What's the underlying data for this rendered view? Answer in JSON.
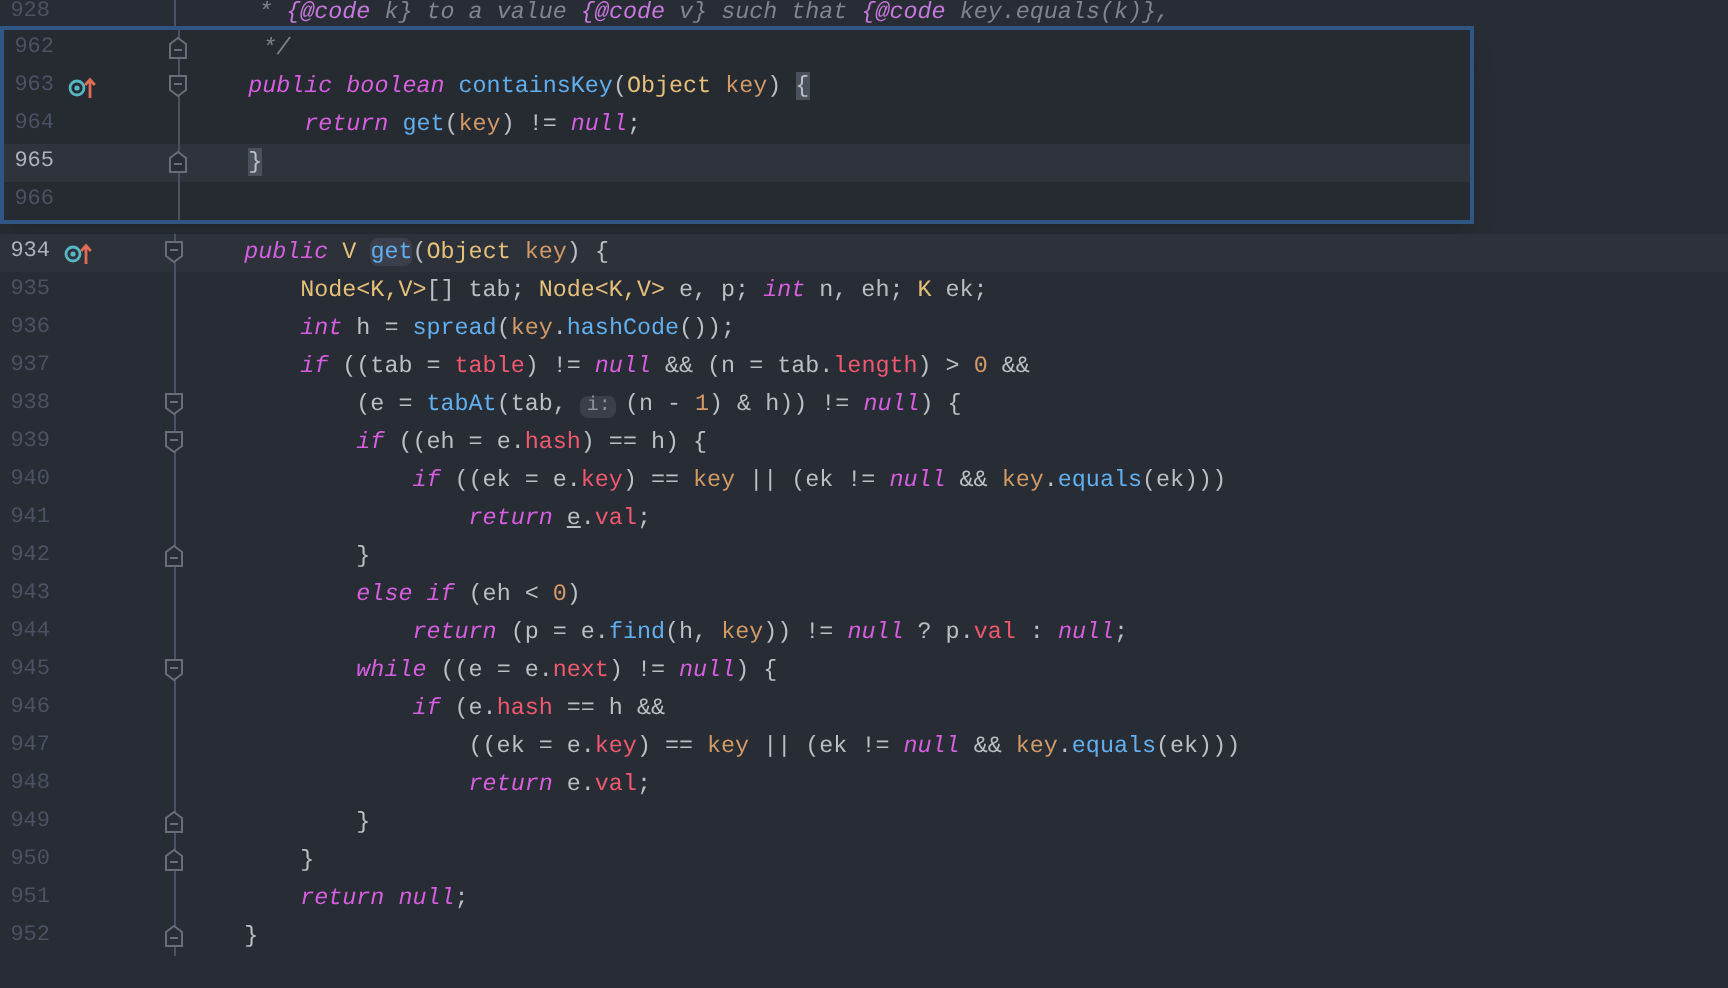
{
  "background_top_line": {
    "number": "928",
    "tokens": [
      {
        "t": "     * ",
        "kind": "comment"
      },
      {
        "t": "{@code",
        "kind": "tag"
      },
      {
        "t": " k} to a value ",
        "kind": "comment"
      },
      {
        "t": "{@code",
        "kind": "tag"
      },
      {
        "t": " v} such that ",
        "kind": "comment"
      },
      {
        "t": "{@code",
        "kind": "tag"
      },
      {
        "t": " key.equals(k)},",
        "kind": "comment"
      }
    ]
  },
  "popup": {
    "lines": [
      {
        "number": "962",
        "current": false,
        "marker": false,
        "fold_start": false,
        "fold_end": true,
        "tokens": [
          {
            "t": "     */",
            "kind": "comment"
          }
        ]
      },
      {
        "number": "963",
        "current": false,
        "marker": true,
        "fold_start": true,
        "fold_end": false,
        "tokens": [
          {
            "t": "    public ",
            "kind": "keyword"
          },
          {
            "t": "boolean ",
            "kind": "keyword"
          },
          {
            "t": "containsKey",
            "kind": "function"
          },
          {
            "t": "(",
            "kind": "plain"
          },
          {
            "t": "Object ",
            "kind": "type"
          },
          {
            "t": "key",
            "kind": "param"
          },
          {
            "t": ") ",
            "kind": "plain"
          },
          {
            "t": "{",
            "kind": "brace"
          }
        ]
      },
      {
        "number": "964",
        "current": false,
        "marker": false,
        "fold_start": false,
        "fold_end": false,
        "tokens": [
          {
            "t": "        return ",
            "kind": "keyword"
          },
          {
            "t": "get",
            "kind": "function"
          },
          {
            "t": "(",
            "kind": "plain"
          },
          {
            "t": "key",
            "kind": "param"
          },
          {
            "t": ") != ",
            "kind": "plain"
          },
          {
            "t": "null",
            "kind": "keyword"
          },
          {
            "t": ";",
            "kind": "plain"
          }
        ]
      },
      {
        "number": "965",
        "current": true,
        "marker": false,
        "fold_start": false,
        "fold_end": true,
        "tokens": [
          {
            "t": "    }",
            "kind": "brace"
          }
        ]
      },
      {
        "number": "966",
        "current": false,
        "marker": false,
        "fold_start": false,
        "fold_end": false
      }
    ]
  },
  "editor": {
    "lines": [
      {
        "number": "934",
        "current": true,
        "marker": true,
        "fold_start": true,
        "fold_end": false,
        "tokens": [
          {
            "t": "    public ",
            "kind": "keyword"
          },
          {
            "t": "V ",
            "kind": "type"
          },
          {
            "t": "get",
            "kind": "function_highlight"
          },
          {
            "t": "(",
            "kind": "plain"
          },
          {
            "t": "Object ",
            "kind": "type"
          },
          {
            "t": "key",
            "kind": "param"
          },
          {
            "t": ") {",
            "kind": "plain"
          }
        ]
      },
      {
        "number": "935",
        "current": false,
        "marker": false,
        "fold_start": false,
        "fold_end": false,
        "tokens": [
          {
            "t": "        Node<K,V>",
            "kind": "type"
          },
          {
            "t": "[] tab; ",
            "kind": "plain"
          },
          {
            "t": "Node<K,V>",
            "kind": "type"
          },
          {
            "t": " e, p; ",
            "kind": "plain"
          },
          {
            "t": "int",
            "kind": "keyword"
          },
          {
            "t": " n, eh; ",
            "kind": "plain"
          },
          {
            "t": "K",
            "kind": "type"
          },
          {
            "t": " ek;",
            "kind": "plain"
          }
        ]
      },
      {
        "number": "936",
        "current": false,
        "marker": false,
        "fold_start": false,
        "fold_end": false,
        "tokens": [
          {
            "t": "        int",
            "kind": "keyword"
          },
          {
            "t": " h = ",
            "kind": "plain"
          },
          {
            "t": "spread",
            "kind": "function"
          },
          {
            "t": "(",
            "kind": "plain"
          },
          {
            "t": "key",
            "kind": "param"
          },
          {
            "t": ".",
            "kind": "plain"
          },
          {
            "t": "hashCode",
            "kind": "function"
          },
          {
            "t": "());",
            "kind": "plain"
          }
        ]
      },
      {
        "number": "937",
        "current": false,
        "marker": false,
        "fold_start": false,
        "fold_end": false,
        "tokens": [
          {
            "t": "        if",
            "kind": "keyword"
          },
          {
            "t": " ((tab = ",
            "kind": "plain"
          },
          {
            "t": "table",
            "kind": "field"
          },
          {
            "t": ") != ",
            "kind": "plain"
          },
          {
            "t": "null",
            "kind": "keyword"
          },
          {
            "t": " && (n = tab.",
            "kind": "plain"
          },
          {
            "t": "length",
            "kind": "field"
          },
          {
            "t": ") > ",
            "kind": "plain"
          },
          {
            "t": "0",
            "kind": "number"
          },
          {
            "t": " &&",
            "kind": "plain"
          }
        ]
      },
      {
        "number": "938",
        "current": false,
        "marker": false,
        "fold_start": true,
        "fold_end": false,
        "tokens": [
          {
            "t": "            (e = ",
            "kind": "plain"
          },
          {
            "t": "tabAt",
            "kind": "function"
          },
          {
            "t": "(tab, ",
            "kind": "plain"
          },
          {
            "t": "i:",
            "kind": "hint"
          },
          {
            "t": "(n - ",
            "kind": "plain"
          },
          {
            "t": "1",
            "kind": "number"
          },
          {
            "t": ") & h)) != ",
            "kind": "plain"
          },
          {
            "t": "null",
            "kind": "keyword"
          },
          {
            "t": ") {",
            "kind": "plain"
          }
        ]
      },
      {
        "number": "939",
        "current": false,
        "marker": false,
        "fold_start": true,
        "fold_end": false,
        "tokens": [
          {
            "t": "            if",
            "kind": "keyword"
          },
          {
            "t": " ((eh = e.",
            "kind": "plain"
          },
          {
            "t": "hash",
            "kind": "field"
          },
          {
            "t": ") == h) {",
            "kind": "plain"
          }
        ]
      },
      {
        "number": "940",
        "current": false,
        "marker": false,
        "fold_start": false,
        "fold_end": false,
        "tokens": [
          {
            "t": "                if",
            "kind": "keyword"
          },
          {
            "t": " ((ek = e.",
            "kind": "plain"
          },
          {
            "t": "key",
            "kind": "field"
          },
          {
            "t": ") == ",
            "kind": "plain"
          },
          {
            "t": "key",
            "kind": "param"
          },
          {
            "t": " || (ek != ",
            "kind": "plain"
          },
          {
            "t": "null",
            "kind": "keyword"
          },
          {
            "t": " && ",
            "kind": "plain"
          },
          {
            "t": "key",
            "kind": "param"
          },
          {
            "t": ".",
            "kind": "plain"
          },
          {
            "t": "equals",
            "kind": "function"
          },
          {
            "t": "(ek)))",
            "kind": "plain"
          }
        ]
      },
      {
        "number": "941",
        "current": false,
        "marker": false,
        "fold_start": false,
        "fold_end": false,
        "tokens": [
          {
            "t": "                    return ",
            "kind": "keyword"
          },
          {
            "t": "e",
            "kind": "underlined"
          },
          {
            "t": ".",
            "kind": "plain"
          },
          {
            "t": "val",
            "kind": "field"
          },
          {
            "t": ";",
            "kind": "plain"
          }
        ]
      },
      {
        "number": "942",
        "current": false,
        "marker": false,
        "fold_start": false,
        "fold_end": true,
        "tokens": [
          {
            "t": "            }",
            "kind": "plain"
          }
        ]
      },
      {
        "number": "943",
        "current": false,
        "marker": false,
        "fold_start": false,
        "fold_end": false,
        "tokens": [
          {
            "t": "            else ",
            "kind": "keyword"
          },
          {
            "t": "if",
            "kind": "keyword"
          },
          {
            "t": " (eh < ",
            "kind": "plain"
          },
          {
            "t": "0",
            "kind": "number"
          },
          {
            "t": ")",
            "kind": "plain"
          }
        ]
      },
      {
        "number": "944",
        "current": false,
        "marker": false,
        "fold_start": false,
        "fold_end": false,
        "tokens": [
          {
            "t": "                return",
            "kind": "keyword"
          },
          {
            "t": " (p = e.",
            "kind": "plain"
          },
          {
            "t": "find",
            "kind": "function"
          },
          {
            "t": "(h, ",
            "kind": "plain"
          },
          {
            "t": "key",
            "kind": "param"
          },
          {
            "t": ")) != ",
            "kind": "plain"
          },
          {
            "t": "null",
            "kind": "keyword"
          },
          {
            "t": " ? p.",
            "kind": "plain"
          },
          {
            "t": "val",
            "kind": "field"
          },
          {
            "t": " : ",
            "kind": "plain"
          },
          {
            "t": "null",
            "kind": "keyword"
          },
          {
            "t": ";",
            "kind": "plain"
          }
        ]
      },
      {
        "number": "945",
        "current": false,
        "marker": false,
        "fold_start": true,
        "fold_end": false,
        "tokens": [
          {
            "t": "            while",
            "kind": "keyword"
          },
          {
            "t": " ((e = e.",
            "kind": "plain"
          },
          {
            "t": "next",
            "kind": "field"
          },
          {
            "t": ") != ",
            "kind": "plain"
          },
          {
            "t": "null",
            "kind": "keyword"
          },
          {
            "t": ") {",
            "kind": "plain"
          }
        ]
      },
      {
        "number": "946",
        "current": false,
        "marker": false,
        "fold_start": false,
        "fold_end": false,
        "tokens": [
          {
            "t": "                if",
            "kind": "keyword"
          },
          {
            "t": " (e.",
            "kind": "plain"
          },
          {
            "t": "hash",
            "kind": "field"
          },
          {
            "t": " == h &&",
            "kind": "plain"
          }
        ]
      },
      {
        "number": "947",
        "current": false,
        "marker": false,
        "fold_start": false,
        "fold_end": false,
        "tokens": [
          {
            "t": "                    ((ek = e.",
            "kind": "plain"
          },
          {
            "t": "key",
            "kind": "field"
          },
          {
            "t": ") == ",
            "kind": "plain"
          },
          {
            "t": "key",
            "kind": "param"
          },
          {
            "t": " || (ek != ",
            "kind": "plain"
          },
          {
            "t": "null",
            "kind": "keyword"
          },
          {
            "t": " && ",
            "kind": "plain"
          },
          {
            "t": "key",
            "kind": "param"
          },
          {
            "t": ".",
            "kind": "plain"
          },
          {
            "t": "equals",
            "kind": "function"
          },
          {
            "t": "(ek)))",
            "kind": "plain"
          }
        ]
      },
      {
        "number": "948",
        "current": false,
        "marker": false,
        "fold_start": false,
        "fold_end": false,
        "tokens": [
          {
            "t": "                    return",
            "kind": "keyword"
          },
          {
            "t": " e.",
            "kind": "plain"
          },
          {
            "t": "val",
            "kind": "field"
          },
          {
            "t": ";",
            "kind": "plain"
          }
        ]
      },
      {
        "number": "949",
        "current": false,
        "marker": false,
        "fold_start": false,
        "fold_end": true,
        "tokens": [
          {
            "t": "            }",
            "kind": "plain"
          }
        ]
      },
      {
        "number": "950",
        "current": false,
        "marker": false,
        "fold_start": false,
        "fold_end": true,
        "tokens": [
          {
            "t": "        }",
            "kind": "plain"
          }
        ]
      },
      {
        "number": "951",
        "current": false,
        "marker": false,
        "fold_start": false,
        "fold_end": false,
        "tokens": [
          {
            "t": "        return ",
            "kind": "keyword"
          },
          {
            "t": "null",
            "kind": "keyword"
          },
          {
            "t": ";",
            "kind": "plain"
          }
        ]
      },
      {
        "number": "952",
        "current": false,
        "marker": false,
        "fold_start": false,
        "fold_end": true,
        "tokens": [
          {
            "t": "    }",
            "kind": "plain"
          }
        ]
      }
    ]
  }
}
